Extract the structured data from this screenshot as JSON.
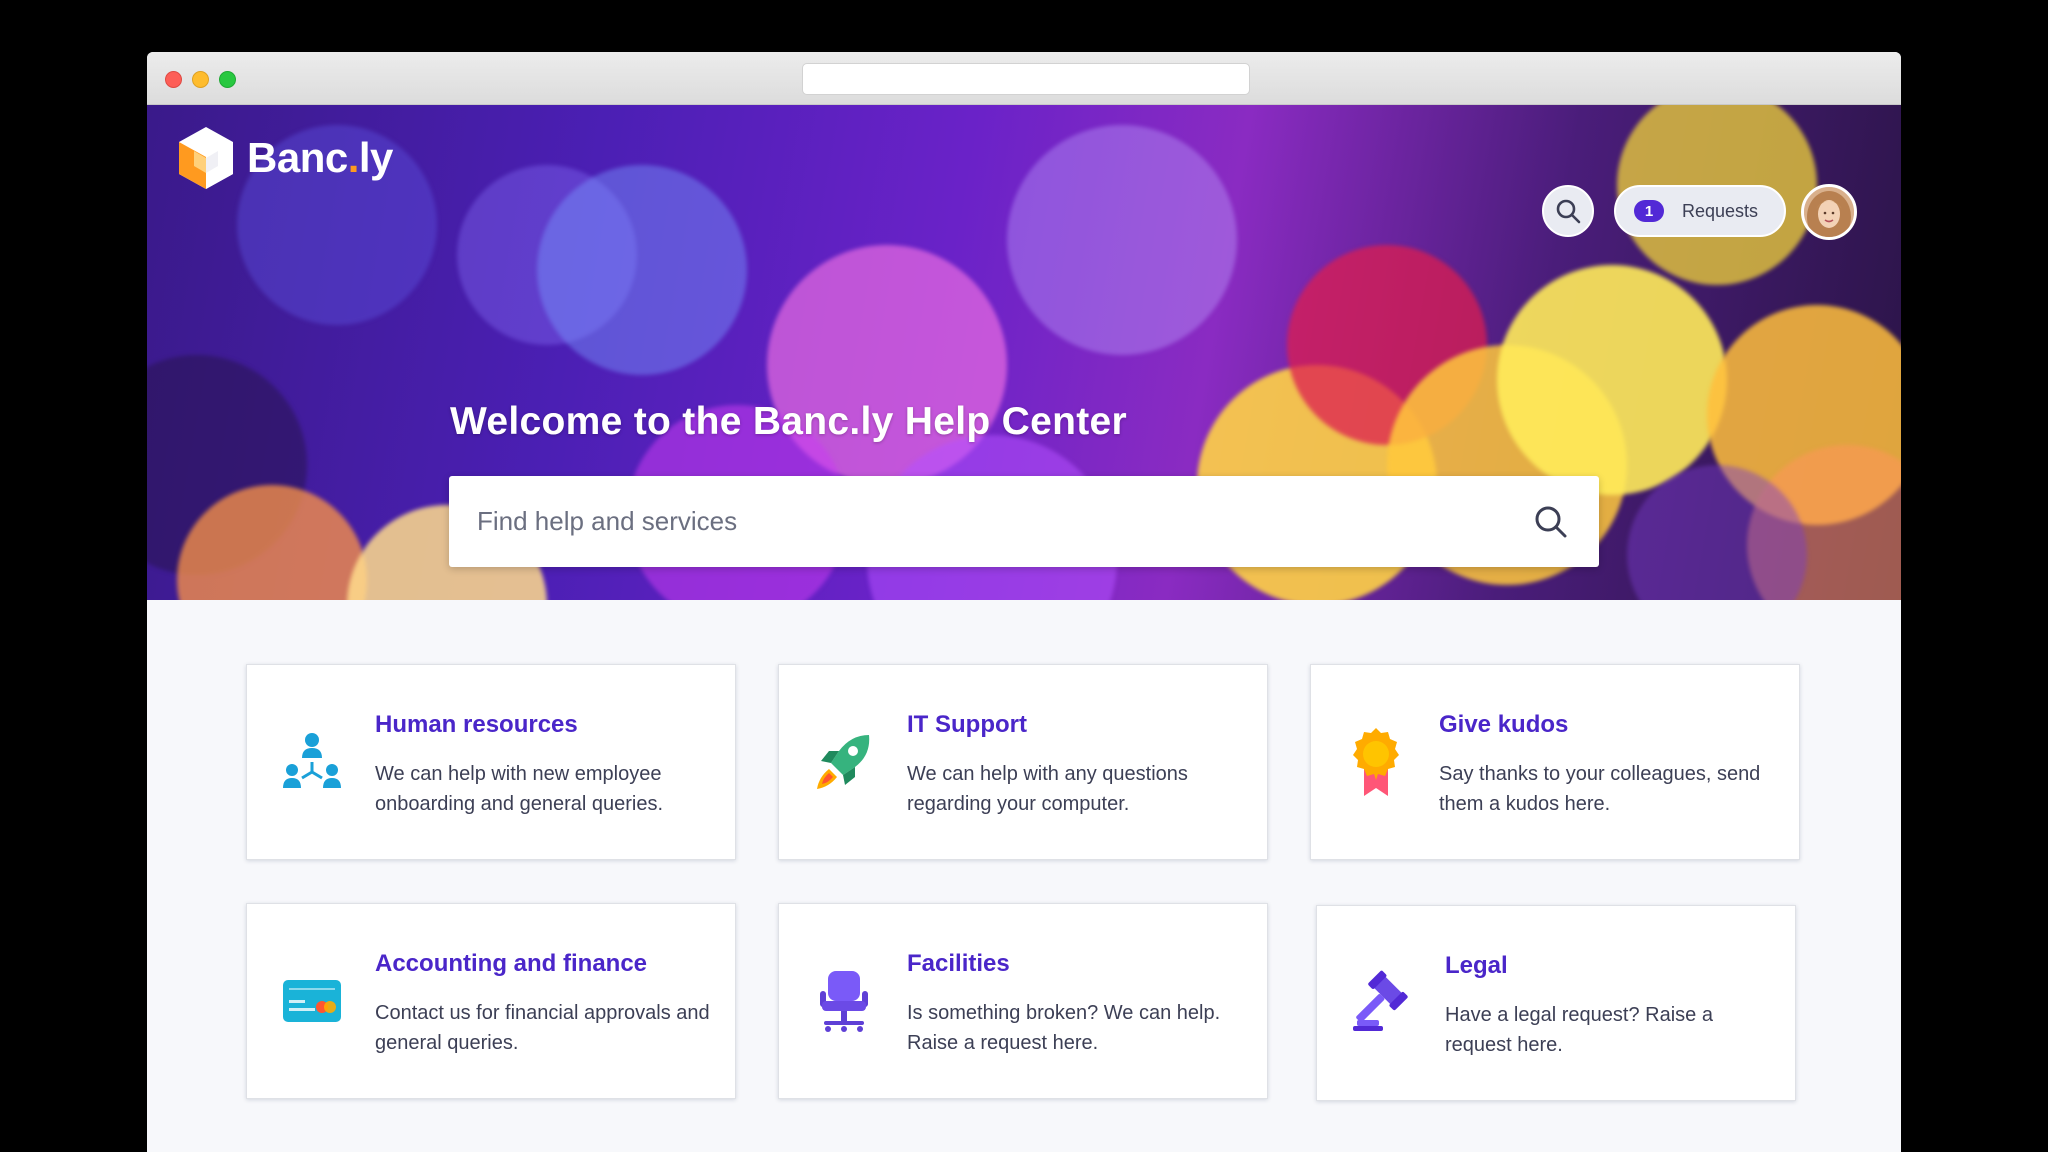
{
  "brand": {
    "name_main": "Banc",
    "name_dot": ".",
    "name_tail": "ly",
    "accent": "#5229d6",
    "orange": "#ff9a1f"
  },
  "header": {
    "search_icon": "search-icon",
    "requests": {
      "count": "1",
      "label": "Requests"
    }
  },
  "hero": {
    "title": "Welcome to the Banc.ly Help Center",
    "search_placeholder": "Find help and services"
  },
  "cards": [
    {
      "title": "Human resources",
      "desc": "We can help with new employee onboarding and general queries.",
      "icon": "people-network-icon"
    },
    {
      "title": "IT Support",
      "desc": "We can help with any questions regarding your computer.",
      "icon": "rocket-icon"
    },
    {
      "title": "Give kudos",
      "desc": "Say thanks to your colleagues, send them a kudos here.",
      "icon": "award-ribbon-icon"
    },
    {
      "title": "Accounting and finance",
      "desc": "Contact us for financial approvals and general queries.",
      "icon": "credit-card-icon"
    },
    {
      "title": "Facilities",
      "desc": "Is something broken? We can help. Raise a request here.",
      "icon": "office-chair-icon"
    },
    {
      "title": "Legal",
      "desc": "Have a legal request? Raise a request here.",
      "icon": "gavel-icon"
    }
  ]
}
